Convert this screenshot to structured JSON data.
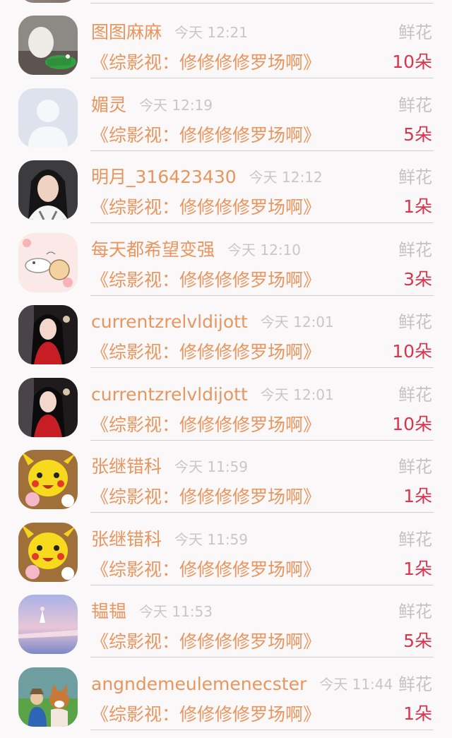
{
  "gift_label": "鲜花",
  "items": [
    {
      "name": "图图麻麻",
      "time": "今天 12:21",
      "book": "《综影视：修修修修罗场啊》",
      "count": "10朵",
      "avatar_icon": "avatar-photo-toy-icon"
    },
    {
      "name": "媚灵",
      "time": "今天 12:19",
      "book": "《综影视：修修修修罗场啊》",
      "count": "5朵",
      "avatar_icon": "default-avatar-icon"
    },
    {
      "name": "明月_316423430",
      "time": "今天 12:12",
      "book": "《综影视：修修修修罗场啊》",
      "count": "1朵",
      "avatar_icon": "avatar-photo-person-icon"
    },
    {
      "name": "每天都希望变强",
      "time": "今天 12:10",
      "book": "《综影视：修修修修罗场啊》",
      "count": "3朵",
      "avatar_icon": "avatar-cats-drawing-icon"
    },
    {
      "name": "currentzrelvldijott",
      "time": "今天 12:01",
      "book": "《综影视：修修修修罗场啊》",
      "count": "10朵",
      "avatar_icon": "avatar-photo-woman-icon"
    },
    {
      "name": "currentzrelvldijott",
      "time": "今天 12:01",
      "book": "《综影视：修修修修罗场啊》",
      "count": "10朵",
      "avatar_icon": "avatar-photo-woman-icon"
    },
    {
      "name": "张继错科",
      "time": "今天 11:59",
      "book": "《综影视：修修修修罗场啊》",
      "count": "1朵",
      "avatar_icon": "avatar-pikachu-icon"
    },
    {
      "name": "张继错科",
      "time": "今天 11:59",
      "book": "《综影视：修修修修罗场啊》",
      "count": "1朵",
      "avatar_icon": "avatar-pikachu-icon"
    },
    {
      "name": "韫韫",
      "time": "今天 11:53",
      "book": "《综影视：修修修修罗场啊》",
      "count": "5朵",
      "avatar_icon": "avatar-sky-scene-icon"
    },
    {
      "name": "angndemeulemenecster",
      "time": "今天 11:44",
      "book": "《综影视：修修修修罗场啊》",
      "count": "1朵",
      "avatar_icon": "avatar-dog-photo-icon"
    }
  ]
}
